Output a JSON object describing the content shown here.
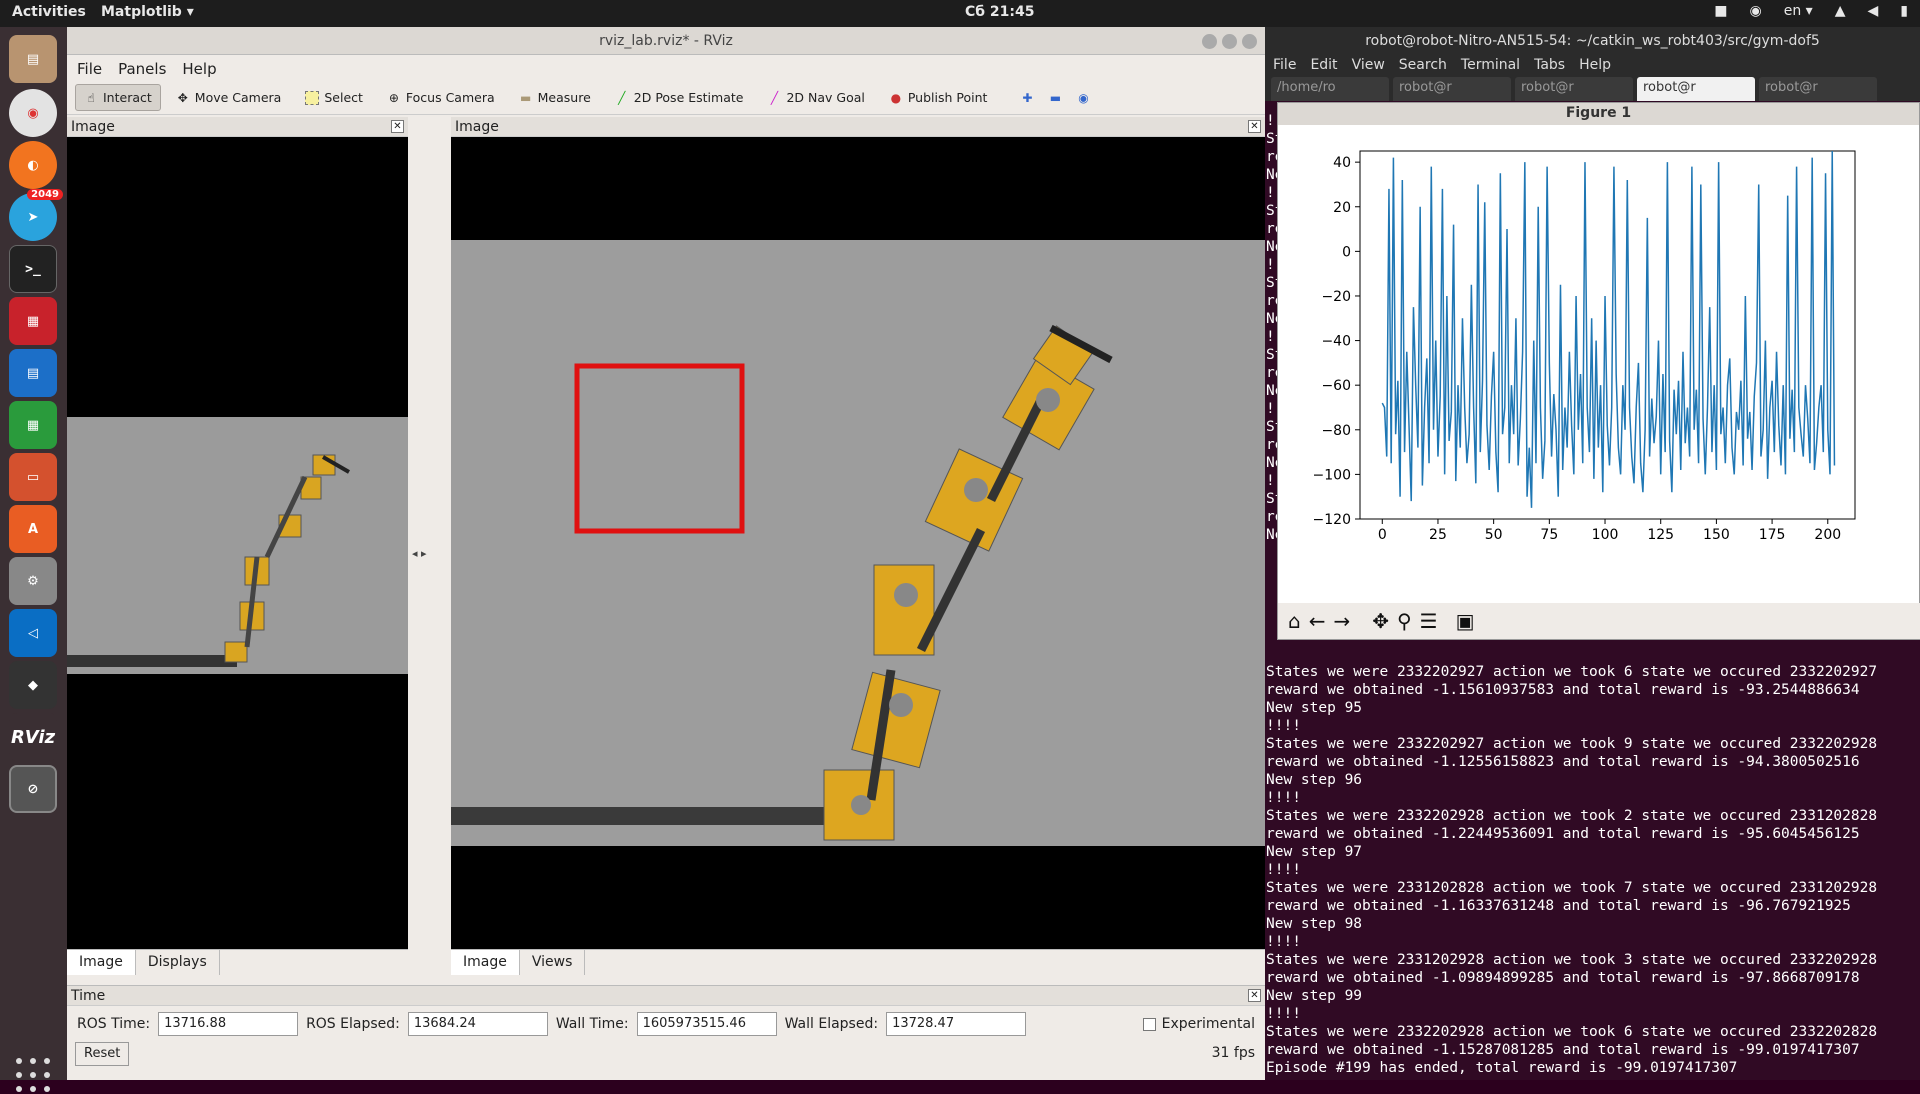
{
  "topbar": {
    "activities": "Activities",
    "app": "Matplotlib ▾",
    "clock": "Сб 21:45",
    "lang": "en ▾"
  },
  "dock": {
    "telegram_badge": "2049",
    "rviz_label": "RViz"
  },
  "rviz": {
    "title": "rviz_lab.rviz* - RViz",
    "menu": [
      "File",
      "Panels",
      "Help"
    ],
    "tools": [
      "Interact",
      "Move Camera",
      "Select",
      "Focus Camera",
      "Measure",
      "2D Pose Estimate",
      "2D Nav Goal",
      "Publish Point"
    ],
    "left_panel_title": "Image",
    "main_panel_title": "Image",
    "left_tabs": [
      "Image",
      "Displays"
    ],
    "main_tabs": [
      "Image",
      "Views"
    ],
    "time": {
      "title": "Time",
      "ros_time_label": "ROS Time:",
      "ros_time": "13716.88",
      "ros_elapsed_label": "ROS Elapsed:",
      "ros_elapsed": "13684.24",
      "wall_time_label": "Wall Time:",
      "wall_time": "1605973515.46",
      "wall_elapsed_label": "Wall Elapsed:",
      "wall_elapsed": "13728.47",
      "experimental": "Experimental",
      "reset": "Reset",
      "fps": "31 fps"
    }
  },
  "terminal": {
    "title": "robot@robot-Nitro-AN515-54: ~/catkin_ws_robt403/src/gym-dof5",
    "menu": [
      "File",
      "Edit",
      "View",
      "Search",
      "Terminal",
      "Tabs",
      "Help"
    ],
    "tabs": [
      "/home/ro",
      "robot@r",
      "robot@r",
      "robot@r",
      "robot@r"
    ],
    "lines": [
      "States we were 2332202927 action we took 6 state we occured 2332202927",
      "reward we obtained -1.15610937583 and total reward is -93.2544886634",
      "New step 95",
      "!!!!",
      "States we were 2332202927 action we took 9 state we occured 2332202928",
      "reward we obtained -1.12556158823 and total reward is -94.3800502516",
      "New step 96",
      "!!!!",
      "States we were 2332202928 action we took 2 state we occured 2331202828",
      "reward we obtained -1.22449536091 and total reward is -95.6045456125",
      "New step 97",
      "!!!!",
      "States we were 2331202828 action we took 7 state we occured 2331202928",
      "reward we obtained -1.16337631248 and total reward is -96.767921925",
      "New step 98",
      "!!!!",
      "States we were 2331202928 action we took 3 state we occured 2332202928",
      "reward we obtained -1.09894899285 and total reward is -97.8668709178",
      "New step 99",
      "!!!!",
      "States we were 2332202928 action we took 6 state we occured 2332202828",
      "reward we obtained -1.15287081285 and total reward is -99.0197417307",
      "Episode #199 has ended, total reward is -99.0197417307"
    ],
    "left_fragments": [
      "!!",
      "St",
      "re",
      "Ne",
      "!!",
      "St",
      "re",
      "Ne",
      "!!",
      "St",
      "re",
      "Ne",
      "!!",
      "St",
      "re",
      "Ne",
      "!!",
      "St",
      "re",
      "Ne",
      "!!",
      "St",
      "re",
      "Ne"
    ]
  },
  "figure": {
    "title": "Figure 1",
    "toolbar_icons": [
      "home-icon",
      "back-icon",
      "forward-icon",
      "pan-icon",
      "zoom-icon",
      "configure-icon",
      "save-icon"
    ]
  },
  "chart_data": {
    "type": "line",
    "title": "",
    "xlabel": "",
    "ylabel": "",
    "xlim": [
      0,
      200
    ],
    "ylim": [
      -120,
      45
    ],
    "xticks": [
      0,
      25,
      50,
      75,
      100,
      125,
      150,
      175,
      200
    ],
    "yticks": [
      40,
      20,
      0,
      -20,
      -40,
      -60,
      -80,
      -100,
      -120
    ],
    "color": "#1f77b4",
    "values": [
      -68,
      -70,
      -92,
      28,
      -95,
      42,
      -82,
      -58,
      -110,
      32,
      -90,
      -45,
      -78,
      -112,
      -25,
      -60,
      -88,
      20,
      -105,
      -70,
      -48,
      -95,
      38,
      -80,
      -40,
      -92,
      -65,
      28,
      -100,
      -20,
      -85,
      -72,
      12,
      -103,
      -60,
      -88,
      -30,
      -70,
      -95,
      -82,
      -15,
      -70,
      -104,
      30,
      -90,
      -58,
      22,
      -78,
      -98,
      -65,
      -45,
      -90,
      -108,
      35,
      -82,
      -70,
      10,
      -95,
      -60,
      -82,
      -30,
      -96,
      -75,
      -45,
      40,
      -110,
      -88,
      -115,
      -40,
      -95,
      20,
      -70,
      -102,
      -85,
      38,
      -50,
      -92,
      -64,
      -80,
      -110,
      -15,
      -98,
      -70,
      -88,
      -45,
      -78,
      -100,
      -20,
      -80,
      -55,
      -95,
      40,
      -70,
      -90,
      -30,
      -102,
      -40,
      -88,
      -60,
      -108,
      -20,
      -78,
      -96,
      -70,
      38,
      -55,
      -88,
      -100,
      -60,
      -80,
      32,
      -70,
      -92,
      -104,
      -70,
      -50,
      -95,
      -108,
      -80,
      15,
      -92,
      -66,
      -86,
      -74,
      -40,
      -100,
      -55,
      -90,
      40,
      -85,
      -108,
      -62,
      -82,
      -58,
      -98,
      -45,
      -86,
      -70,
      -92,
      38,
      -80,
      -62,
      -95,
      30,
      -75,
      -100,
      -70,
      -25,
      -90,
      -60,
      -98,
      40,
      -82,
      -70,
      -95,
      -60,
      -48,
      -88,
      -100,
      -72,
      -80,
      -58,
      -96,
      -20,
      -84,
      -72,
      -98,
      -65,
      -50,
      30,
      -92,
      -80,
      -40,
      -102,
      -70,
      -58,
      -90,
      -45,
      -78,
      -96,
      -60,
      -100,
      25,
      -84,
      -62,
      -90,
      38,
      -70,
      -82,
      -92,
      -60,
      -75,
      -95,
      42,
      -98,
      -86,
      -70,
      -60,
      -90,
      35,
      -80,
      -100,
      45,
      -96
    ]
  }
}
